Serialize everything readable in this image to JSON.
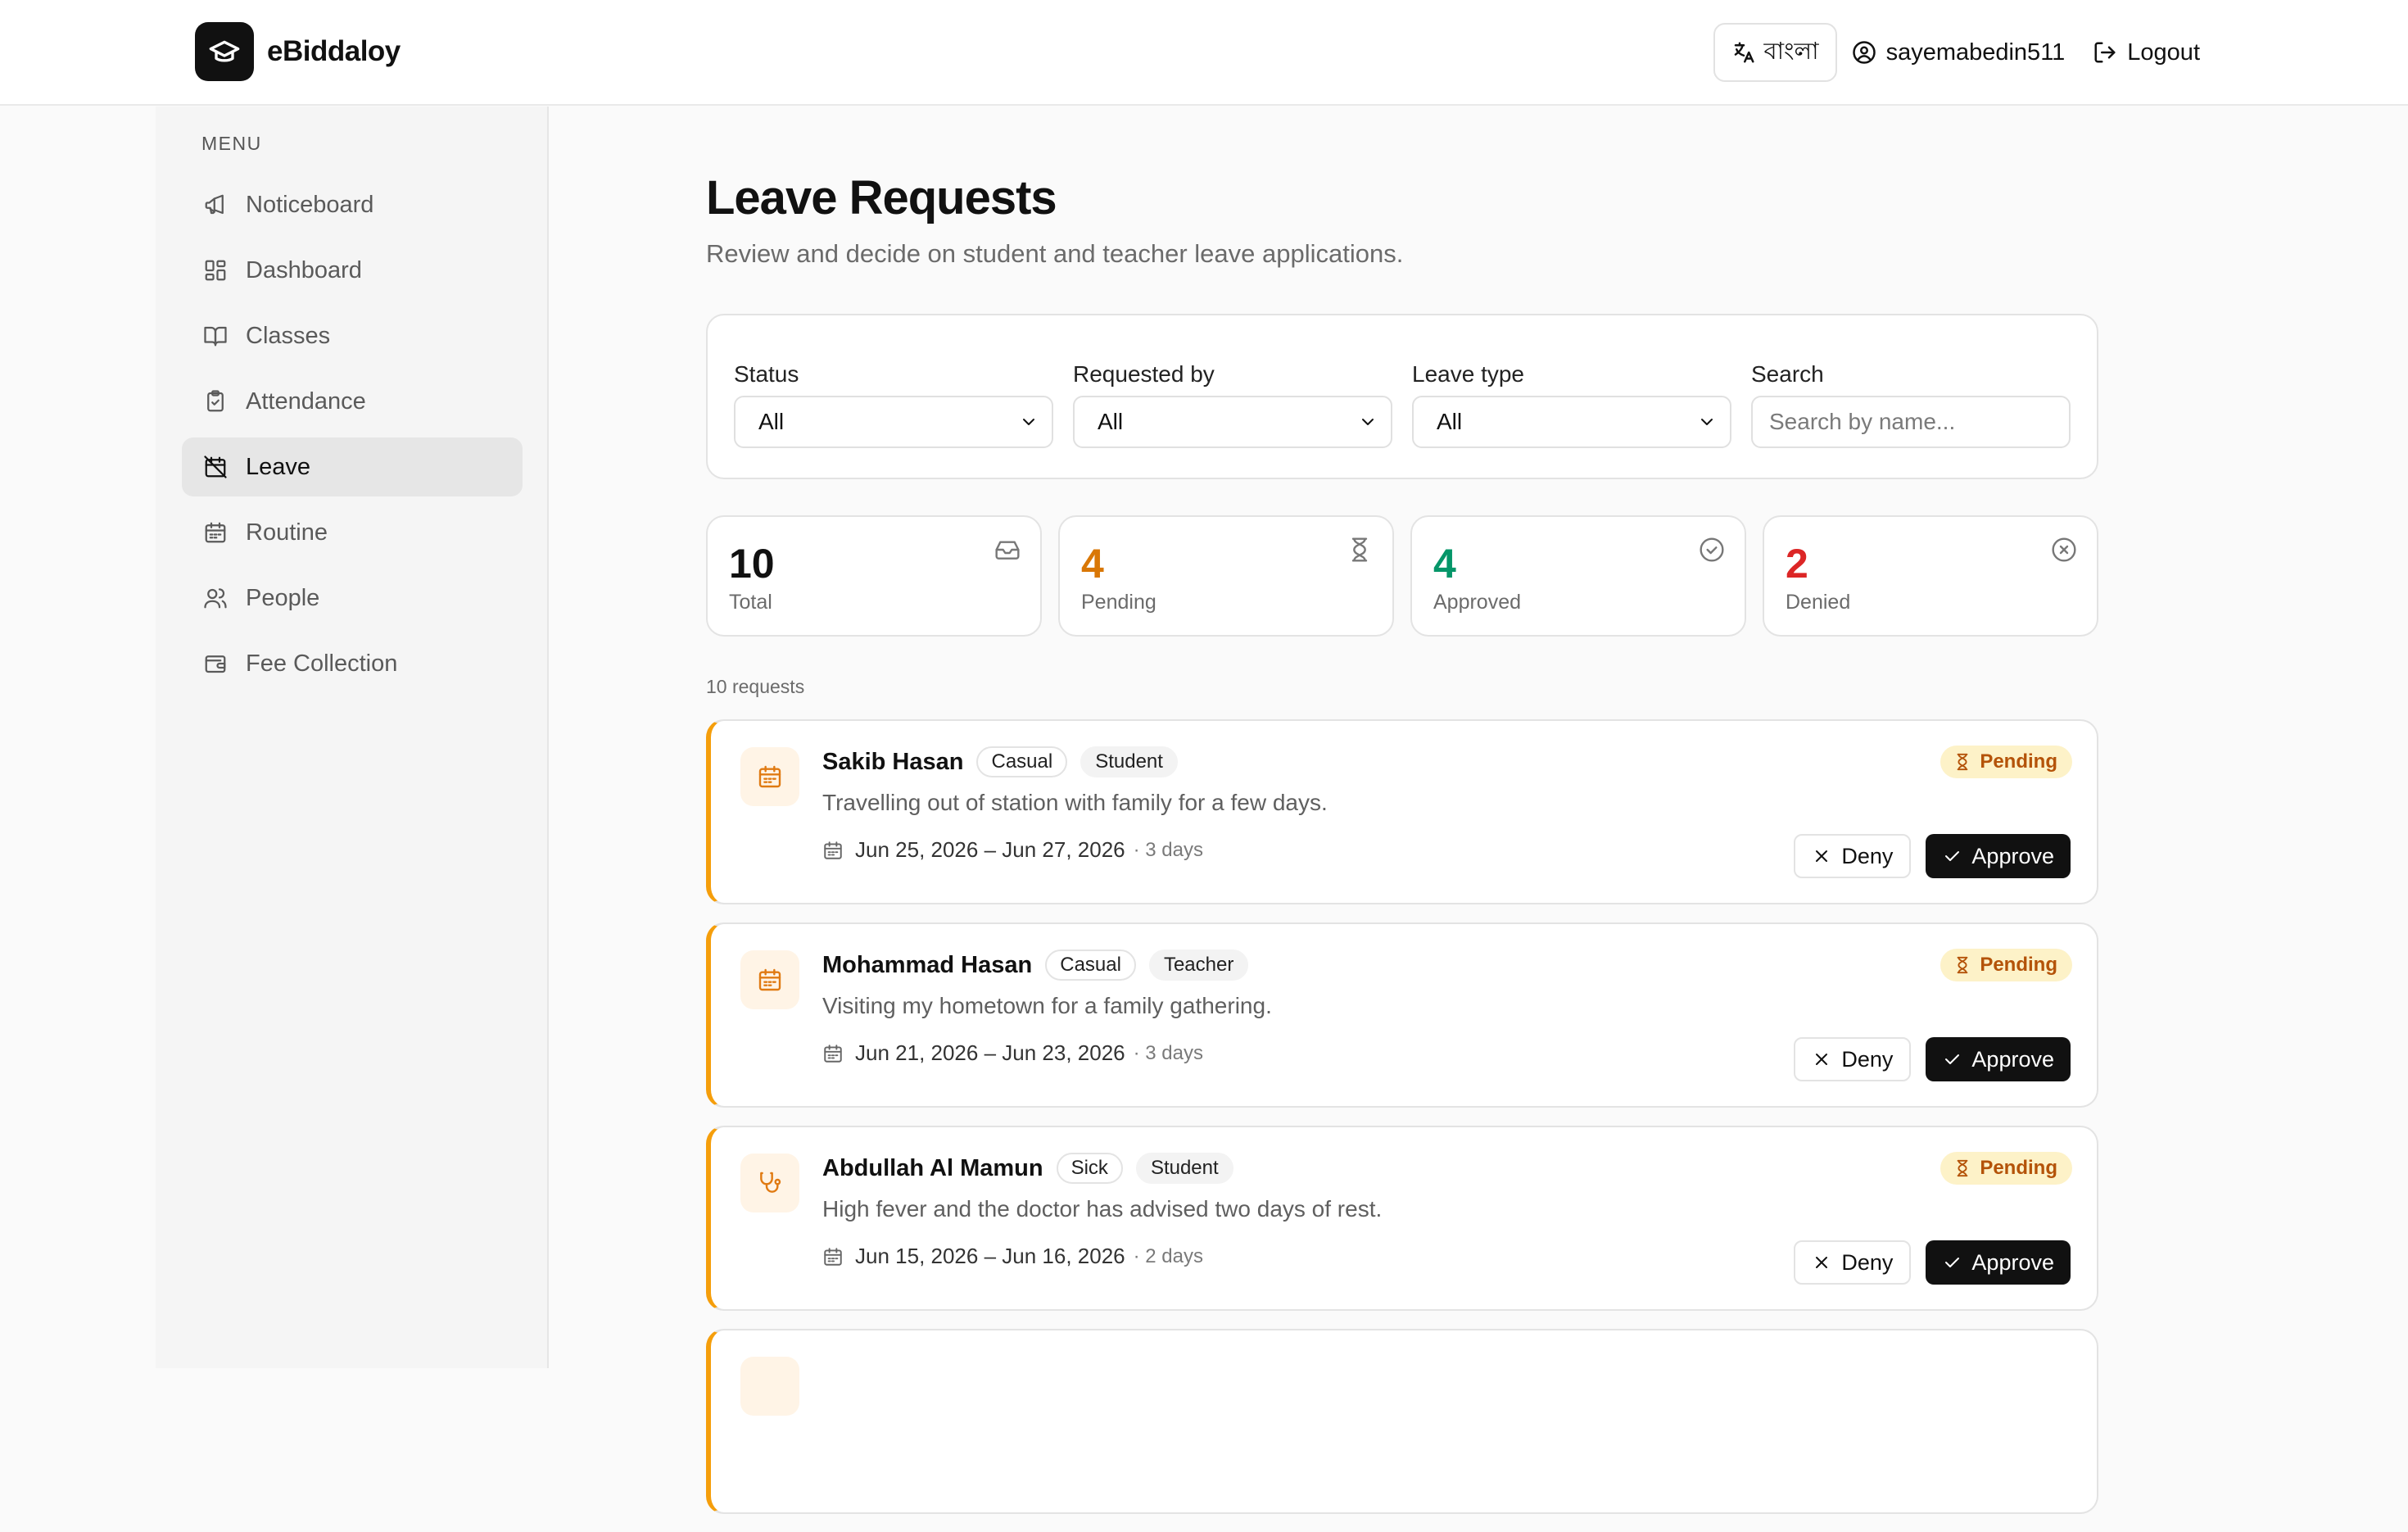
{
  "app": {
    "name": "eBiddaloy"
  },
  "header": {
    "lang_label": "বাংলা",
    "username": "sayemabedin511",
    "logout_label": "Logout"
  },
  "sidebar": {
    "menu_label": "MENU",
    "items": [
      {
        "label": "Noticeboard",
        "icon": "megaphone-icon"
      },
      {
        "label": "Dashboard",
        "icon": "dashboard-icon"
      },
      {
        "label": "Classes",
        "icon": "book-icon"
      },
      {
        "label": "Attendance",
        "icon": "clipboard-check-icon"
      },
      {
        "label": "Leave",
        "icon": "calendar-off-icon",
        "active": true
      },
      {
        "label": "Routine",
        "icon": "calendar-icon"
      },
      {
        "label": "People",
        "icon": "users-icon"
      },
      {
        "label": "Fee Collection",
        "icon": "wallet-icon"
      }
    ]
  },
  "main": {
    "title": "Leave Requests",
    "subtitle": "Review and decide on student and teacher leave applications.",
    "filters": {
      "status": {
        "label": "Status",
        "value": "All"
      },
      "requested_by": {
        "label": "Requested by",
        "value": "All"
      },
      "leave_type": {
        "label": "Leave type",
        "value": "All"
      },
      "search": {
        "label": "Search",
        "placeholder": "Search by name..."
      }
    },
    "stats": [
      {
        "value": "10",
        "label": "Total",
        "color": "#111111",
        "icon": "inbox-icon"
      },
      {
        "value": "4",
        "label": "Pending",
        "color": "#d97706",
        "icon": "hourglass-icon"
      },
      {
        "value": "4",
        "label": "Approved",
        "color": "#059669",
        "icon": "check-circle-icon"
      },
      {
        "value": "2",
        "label": "Denied",
        "color": "#dc2626",
        "icon": "x-circle-icon"
      }
    ],
    "request_count": "10 requests",
    "requests": [
      {
        "name": "Sakib Hasan",
        "type": "Casual",
        "role": "Student",
        "reason": "Travelling out of station with family for a few days.",
        "dates": "Jun 25, 2026 – Jun 27, 2026",
        "days": "· 3 days",
        "status": "Pending",
        "icon": "calendar-icon"
      },
      {
        "name": "Mohammad Hasan",
        "type": "Casual",
        "role": "Teacher",
        "reason": "Visiting my hometown for a family gathering.",
        "dates": "Jun 21, 2026 – Jun 23, 2026",
        "days": "· 3 days",
        "status": "Pending",
        "icon": "calendar-icon"
      },
      {
        "name": "Abdullah Al Mamun",
        "type": "Sick",
        "role": "Student",
        "reason": "High fever and the doctor has advised two days of rest.",
        "dates": "Jun 15, 2026 – Jun 16, 2026",
        "days": "· 2 days",
        "status": "Pending",
        "icon": "stethoscope-icon"
      }
    ],
    "actions": {
      "deny_label": "Deny",
      "approve_label": "Approve"
    }
  },
  "colors": {
    "accent_pending": "#f59e0b",
    "approve_bg": "#111111"
  }
}
